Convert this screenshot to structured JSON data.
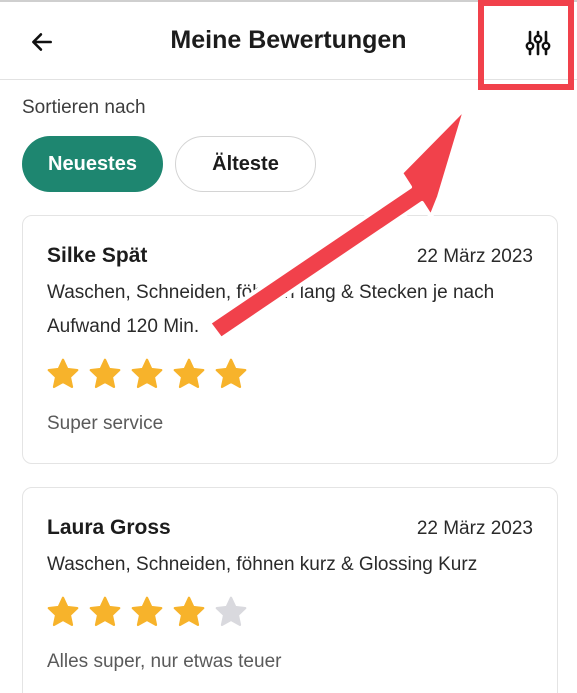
{
  "header": {
    "title": "Meine Bewertungen",
    "back_icon": "arrow-left-icon",
    "filter_icon": "sliders-icon"
  },
  "sort": {
    "label": "Sortieren nach",
    "options": [
      {
        "label": "Neuestes",
        "selected": true
      },
      {
        "label": "Älteste",
        "selected": false
      }
    ]
  },
  "reviews": [
    {
      "name": "Silke Spät",
      "date": "22 März 2023",
      "service": "Waschen, Schneiden, föhnen lang & Stecken je nach Aufwand 120 Min.",
      "rating": 5,
      "comment": "Super service"
    },
    {
      "name": "Laura Gross",
      "date": "22 März 2023",
      "service": "Waschen, Schneiden, föhnen kurz & Glossing Kurz",
      "rating": 4,
      "comment": "Alles super, nur etwas teuer"
    }
  ],
  "colors": {
    "accent": "#1e8670",
    "star_filled": "#f7b32b",
    "star_empty": "#d9d9de",
    "annotation": "#f1414b"
  }
}
